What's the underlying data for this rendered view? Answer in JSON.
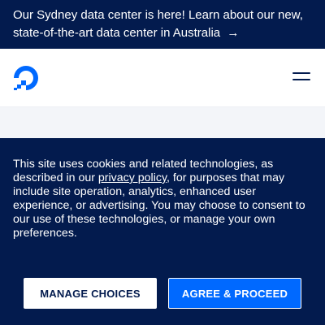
{
  "announcement": {
    "text": "Our Sydney data center is here! Learn about our new, state-of-the-art data center in Australia",
    "arrow": "→"
  },
  "navbar": {
    "logo_icon": "digitalocean-logo-icon",
    "menu_icon": "hamburger-menu-icon"
  },
  "cookie_banner": {
    "text_before": "This site uses cookies and related technologies, as described in our ",
    "link_text": "privacy policy",
    "text_after": ", for purposes that may include site operation, analytics, enhanced user experience, or advertising. You may choose to consent to our use of these technologies, or manage your own preferences.",
    "manage_label": "MANAGE CHOICES",
    "agree_label": "AGREE & PROCEED"
  },
  "colors": {
    "navy": "#031b4e",
    "brand_blue": "#0069ff"
  }
}
